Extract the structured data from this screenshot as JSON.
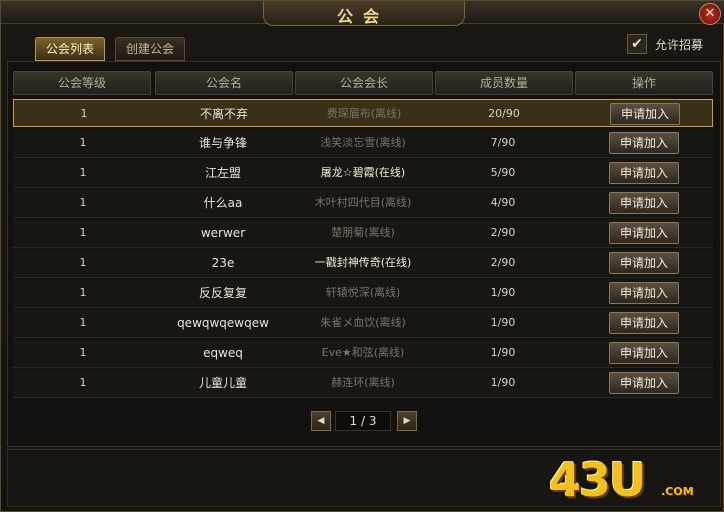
{
  "window": {
    "title": "公会",
    "close": "✕"
  },
  "tabs": [
    {
      "label": "公会列表",
      "active": true
    },
    {
      "label": "创建公会",
      "active": false
    }
  ],
  "allow_recruit": {
    "label": "允许招募",
    "checked": true,
    "mark": "✔"
  },
  "table": {
    "headers": [
      "公会等级",
      "公会名",
      "公会会长",
      "成员数量",
      "操作"
    ],
    "rows": [
      {
        "level": "1",
        "name": "不离不弃",
        "leader": "费琛眉布(离线)",
        "online": false,
        "count": "20/90",
        "action": "申请加入"
      },
      {
        "level": "1",
        "name": "谁与争锋",
        "leader": "浅笑淡忘雪(离线)",
        "online": false,
        "count": "7/90",
        "action": "申请加入"
      },
      {
        "level": "1",
        "name": "江左盟",
        "leader": "屠龙☆碧霞(在线)",
        "online": true,
        "count": "5/90",
        "action": "申请加入"
      },
      {
        "level": "1",
        "name": "什么aa",
        "leader": "木叶村四代目(离线)",
        "online": false,
        "count": "4/90",
        "action": "申请加入"
      },
      {
        "level": "1",
        "name": "werwer",
        "leader": "楚朋菊(离线)",
        "online": false,
        "count": "2/90",
        "action": "申请加入"
      },
      {
        "level": "1",
        "name": "23e",
        "leader": "一戳封神传奇(在线)",
        "online": true,
        "count": "2/90",
        "action": "申请加入"
      },
      {
        "level": "1",
        "name": "反反复复",
        "leader": "轩辕悦深(离线)",
        "online": false,
        "count": "1/90",
        "action": "申请加入"
      },
      {
        "level": "1",
        "name": "qewqwqewqew",
        "leader": "朱雀メ血饮(离线)",
        "online": false,
        "count": "1/90",
        "action": "申请加入"
      },
      {
        "level": "1",
        "name": "eqweq",
        "leader": "Eve★和弦(离线)",
        "online": false,
        "count": "1/90",
        "action": "申请加入"
      },
      {
        "level": "1",
        "name": "儿童儿童",
        "leader": "赫连环(离线)",
        "online": false,
        "count": "1/90",
        "action": "申请加入"
      }
    ]
  },
  "pagination": {
    "text": "1 / 3",
    "prev": "◀",
    "next": "▶"
  },
  "logo": {
    "main": "43U",
    "sub": ".COM"
  },
  "colors": {
    "accent": "#c8a040",
    "online_text": "#f0ead8",
    "offline_text": "#7a7468"
  }
}
